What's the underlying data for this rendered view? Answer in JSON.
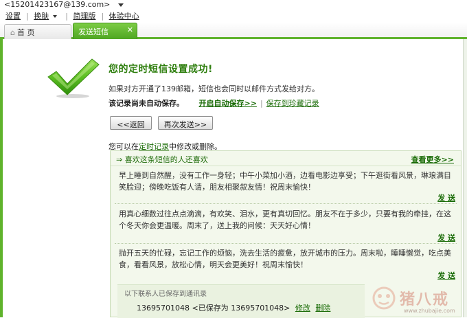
{
  "topbar": {
    "account": "<15201423167@139.com>",
    "links": {
      "settings": "设置",
      "skin": "换肤",
      "simple": "简理版",
      "experience": "体验中心"
    }
  },
  "tabs": {
    "home": "首 页",
    "active": "发送短信",
    "close": "✕"
  },
  "result": {
    "title": "您的定时短信设置成功!",
    "desc": "如果对方开通了139邮箱，短信也会同时以邮件方式发给对方。",
    "not_saved": "该记录尚未自动保存。",
    "auto_save": "开启自动保存>>",
    "separator": "|",
    "save_favorite": "保存到珍藏记录"
  },
  "buttons": {
    "back": "<<返回",
    "resend": "再次发送>>"
  },
  "modify_line": {
    "prefix": "您可以在",
    "link": "定时记录",
    "suffix": "中修改或删除。"
  },
  "panel": {
    "title": "⇒ 喜欢这条短信的人还喜欢",
    "more": "查看更多>>",
    "messages": [
      {
        "text": "早上睡到自然醒，没有工作一身轻；中午小菜加小酒，边看电影边享受；下午逛街看风景，琳琅满目笑脸迎；傍晚吃饭有人请，朋友相聚叙友情！祝周末愉快！",
        "send": "发 送"
      },
      {
        "text": "用真心细数过往点点滴滴，有欢笑、泪水，更有真切回忆。朋友不在于多少，只要有我的牵挂，在这个冬天你会更温暖。周末了，送上我的问候：天天好心情！",
        "send": "发 送"
      },
      {
        "text": "抛开五天的忙碌，忘记工作的烦恼，洗去生活的疲惫，放开城市的压力。周末啦，睡睡懒觉，吃点美食，看看风景，放松心情，明天会更美好！祝周末愉快！",
        "send": "发 送"
      }
    ],
    "contacts": {
      "header": "以下联系人已保存到通讯录",
      "number": "13695701048",
      "saved_as": "<已保存为 13695701048>",
      "edit": "修改",
      "delete": "删除"
    }
  },
  "watermark": {
    "text": "猪八戒",
    "url": "www.zhubajie.com"
  },
  "colors": {
    "brand_green": "#5fb32c",
    "link_green": "#1c6d09",
    "title_green": "#2f7f0f",
    "panel_bg": "#f3f8ec"
  },
  "icons": {
    "success": "check-mark-icon",
    "home": "home-icon",
    "close": "close-icon"
  }
}
